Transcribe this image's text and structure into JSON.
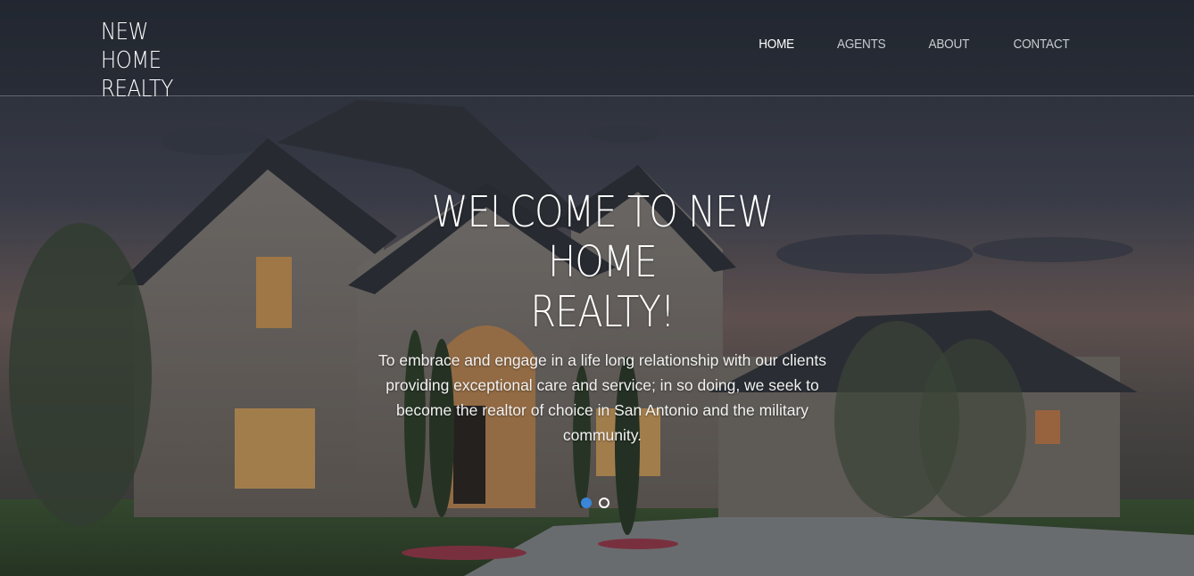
{
  "brand": {
    "line1": "NEW HOME",
    "line2": "REALTY"
  },
  "nav": {
    "items": [
      {
        "label": "HOME",
        "active": true
      },
      {
        "label": "AGENTS",
        "active": false
      },
      {
        "label": "ABOUT",
        "active": false
      },
      {
        "label": "CONTACT",
        "active": false
      }
    ]
  },
  "hero": {
    "title_line1": "WELCOME TO NEW HOME",
    "title_line2": "REALTY!",
    "description": "To embrace and engage in a life long relationship with our clients providing exceptional care and service; in so doing, we seek to become the realtor of choice in San Antonio and the military community."
  },
  "carousel": {
    "slide_count": 2,
    "active_slide": 1
  },
  "colors": {
    "accent": "#3a86d8",
    "nav_active": "#ffffff",
    "nav_inactive": "#c9ccd2"
  },
  "icons": {
    "carousel_indicator": "dot-indicator"
  }
}
